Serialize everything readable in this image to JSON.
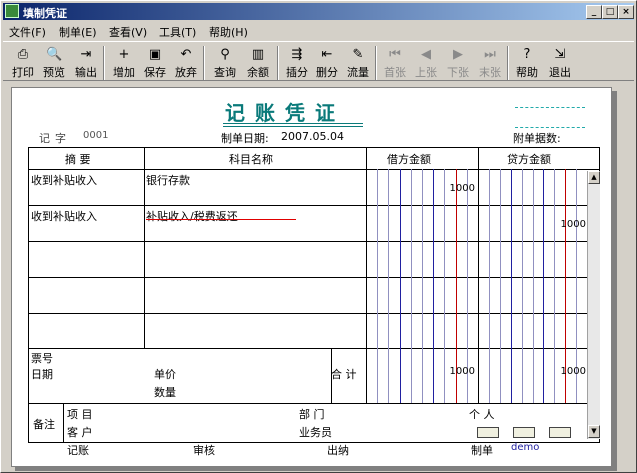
{
  "window": {
    "title": "填制凭证",
    "min": "_",
    "max": "□",
    "close": "×"
  },
  "menu": [
    "文件(F)",
    "制单(E)",
    "查看(V)",
    "工具(T)",
    "帮助(H)"
  ],
  "toolbar": [
    {
      "label": "打印",
      "icon": "printer-icon",
      "glyph": "⎙"
    },
    {
      "label": "预览",
      "icon": "preview-icon",
      "glyph": "🔍"
    },
    {
      "label": "输出",
      "icon": "export-icon",
      "glyph": "⇥"
    },
    {
      "label": "增加",
      "icon": "add-icon",
      "glyph": "+"
    },
    {
      "label": "保存",
      "icon": "save-icon",
      "glyph": "▣"
    },
    {
      "label": "放弃",
      "icon": "undo-icon",
      "glyph": "↶"
    },
    {
      "label": "查询",
      "icon": "binoculars-icon",
      "glyph": "⚲"
    },
    {
      "label": "余额",
      "icon": "bar-chart-icon",
      "glyph": "▥"
    },
    {
      "label": "插分",
      "icon": "insert-row-icon",
      "glyph": "⇶"
    },
    {
      "label": "删分",
      "icon": "delete-row-icon",
      "glyph": "⇤"
    },
    {
      "label": "流量",
      "icon": "flow-icon",
      "glyph": "✎"
    },
    {
      "label": "首张",
      "icon": "first-icon",
      "glyph": "⏮",
      "disabled": true
    },
    {
      "label": "上张",
      "icon": "prev-icon",
      "glyph": "◀",
      "disabled": true
    },
    {
      "label": "下张",
      "icon": "next-icon",
      "glyph": "▶",
      "disabled": true
    },
    {
      "label": "末张",
      "icon": "last-icon",
      "glyph": "⏭",
      "disabled": true
    },
    {
      "label": "帮助",
      "icon": "help-icon",
      "glyph": "?"
    },
    {
      "label": "退出",
      "icon": "exit-icon",
      "glyph": "⇲"
    }
  ],
  "voucher": {
    "title": "记账凭证",
    "type_label": "记",
    "type_label2": "字",
    "number": "0001",
    "date_label": "制单日期:",
    "date": "2007.05.04",
    "attach_label": "附单据数:",
    "headers": {
      "summary": "摘 要",
      "account": "科目名称",
      "debit": "借方金额",
      "credit": "贷方金额"
    },
    "rows": [
      {
        "summary": "收到补贴收入",
        "account": "银行存款",
        "debit": "1000",
        "credit": ""
      },
      {
        "summary": "收到补贴收入",
        "account": "补贴收入/税费返还",
        "debit": "",
        "credit": "1000"
      },
      {
        "summary": "",
        "account": "",
        "debit": "",
        "credit": ""
      },
      {
        "summary": "",
        "account": "",
        "debit": "",
        "credit": ""
      },
      {
        "summary": "",
        "account": "",
        "debit": "",
        "credit": ""
      }
    ],
    "bill_no_label": "票号",
    "date_label2": "日期",
    "price_label": "单价",
    "qty_label": "数量",
    "total_label": "合 计",
    "total_debit": "1000",
    "total_credit": "1000",
    "remark_label": "备注",
    "project_label": "项 目",
    "dept_label": "部 门",
    "person_label": "个 人",
    "customer_label": "客 户",
    "salesman_label": "业务员",
    "footer": {
      "post": "记账",
      "audit": "审核",
      "cashier": "出纳",
      "maker": "制单",
      "maker_name": "demo"
    }
  },
  "colors": {
    "title_teal": "#0a7a7a",
    "red_underline": "#e00000",
    "blue_grid": "#2020a0",
    "red_grid": "#c00000"
  }
}
